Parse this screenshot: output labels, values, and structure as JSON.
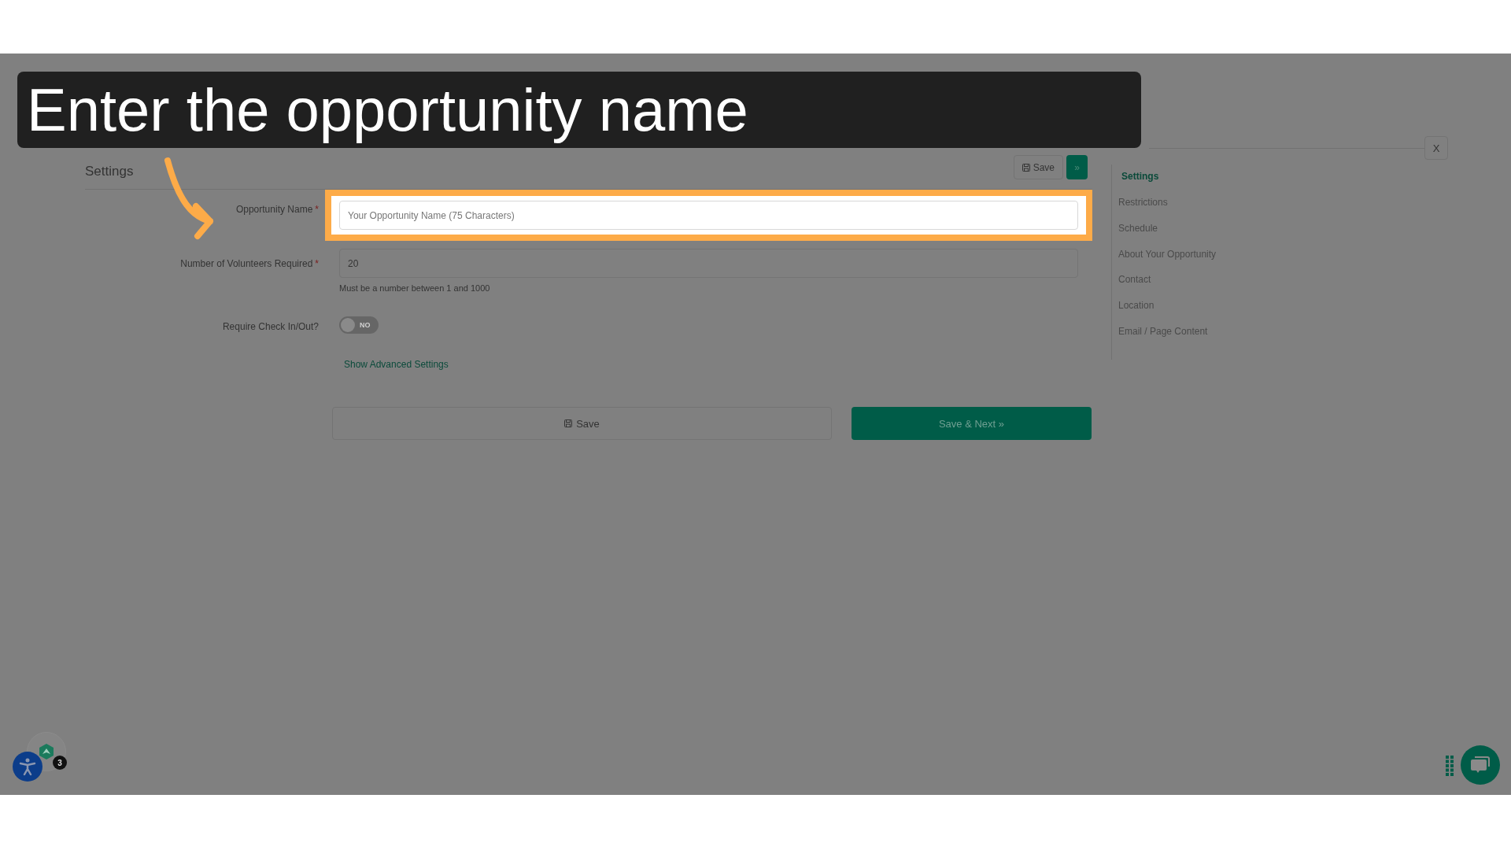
{
  "caption": "Enter the opportunity name",
  "close_button": "X",
  "section_title": "Settings",
  "header_buttons": {
    "save": "Save",
    "next": "»"
  },
  "form": {
    "fields": [
      {
        "kind": "text",
        "label": "Opportunity Name",
        "required_mark": "*",
        "placeholder": "Your Opportunity Name (75 Characters)",
        "highlighted": true
      },
      {
        "kind": "text",
        "label": "Number of Volunteers Required",
        "required_mark": "*",
        "value": "20",
        "hint": "Must be a number between 1 and 1000",
        "highlighted": false
      },
      {
        "kind": "toggle",
        "label": "Require Check In/Out?",
        "on": false,
        "state_label": "NO"
      }
    ]
  },
  "advanced_link": "Show Advanced Settings",
  "footer_buttons": {
    "save": "Save",
    "save_next": "Save & Next »"
  },
  "sidebar": {
    "items": [
      {
        "label": "Settings",
        "selected": true
      },
      {
        "label": "Restrictions",
        "selected": false
      },
      {
        "label": "Schedule",
        "selected": false
      },
      {
        "label": "About Your Opportunity",
        "selected": false
      },
      {
        "label": "Contact",
        "selected": false
      },
      {
        "label": "Location",
        "selected": false
      },
      {
        "label": "Email / Page Content",
        "selected": false
      }
    ]
  },
  "widgets": {
    "badge_count": "3"
  }
}
